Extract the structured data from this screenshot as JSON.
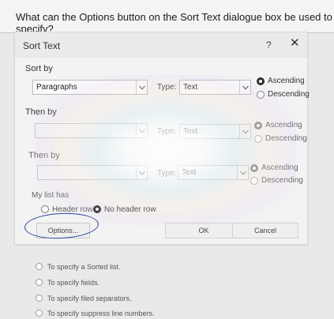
{
  "question": "What can the Options button on the Sort Text dialogue box be used to specify?",
  "dialog": {
    "title": "Sort Text",
    "help": "?",
    "close": "✕",
    "sort_by": {
      "label": "Sort by",
      "field_value": "Paragraphs",
      "type_label": "Type:",
      "type_value": "Text",
      "ascending": "Ascending",
      "descending": "Descending"
    },
    "then_by_1": {
      "label": "Then by",
      "field_value": "",
      "type_label": "Type:",
      "type_value": "Text",
      "ascending": "Ascending",
      "descending": "Descending"
    },
    "then_by_2": {
      "label": "Then by",
      "field_value": "",
      "type_label": "Type:",
      "type_value": "Text",
      "ascending": "Ascending",
      "descending": "Descending"
    },
    "my_list_has": {
      "label": "My list has",
      "header_row": "Header row",
      "no_header_row": "No header row"
    },
    "options_button": "Options...",
    "ok_button": "OK",
    "cancel_button": "Cancel"
  },
  "answers": [
    "To specify a Sorted list.",
    "To specify fields.",
    "To specify filed separators.",
    "To specify suppress line numbers."
  ],
  "colors": {
    "annotation_circle": "#2a4c9a",
    "selected_radio": "#2d2d2d"
  }
}
